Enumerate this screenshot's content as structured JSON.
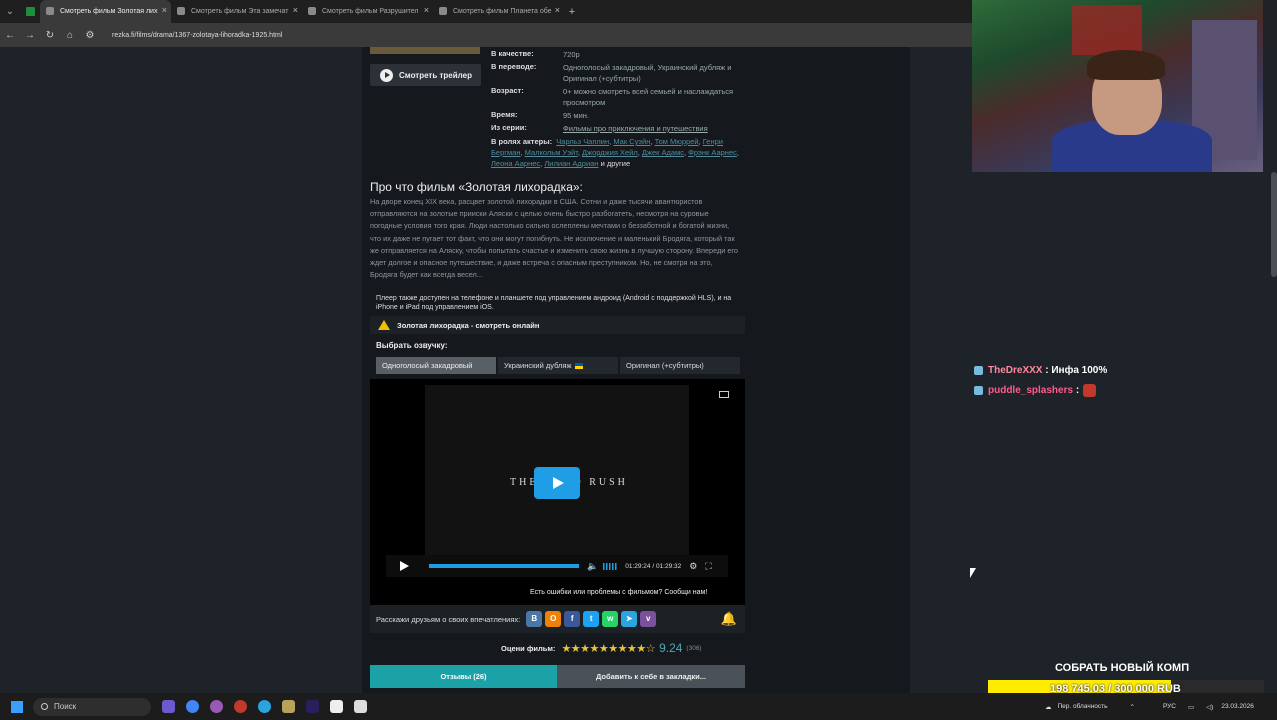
{
  "browser": {
    "tabs": [
      {
        "title": "Смотреть фильм Золотая лих",
        "active": true
      },
      {
        "title": "Смотреть фильм Эта замечат",
        "active": false
      },
      {
        "title": "Смотреть фильм Разрушител",
        "active": false
      },
      {
        "title": "Смотреть фильм Планета обе",
        "active": false
      }
    ],
    "new_tab": "+",
    "url": "rezka.fi/films/drama/1367-zolotaya-lihoradka-1925.html"
  },
  "movie": {
    "trailer_button": "Смотреть трейлер",
    "info": [
      {
        "key": "В качестве:",
        "value": "720p"
      },
      {
        "key": "В переводе:",
        "value": "Одноголосый закадровый, Украинский дубляж и Оригинал (+субтитры)"
      },
      {
        "key": "Возраст:",
        "value": "0+ можно смотреть всей семьей и наслаждаться просмотром"
      },
      {
        "key": "Время:",
        "value": "95 мин."
      }
    ],
    "series_label": "Из серии:",
    "series_value": "Фильмы про приключения и путешествия",
    "actors_label": "В ролях актеры:",
    "actors": [
      "Чарльз Чаплин",
      "Мак Суэйн",
      "Том Мюррей",
      "Генри Бергман",
      "Малкольм Уэйт",
      "Джорджия Хейл",
      "Джек Адамс",
      "Фрэнк Аарнес",
      "Леона Аарнес",
      "Лилиан Адриан"
    ],
    "actors_more": "и другие",
    "about_title": "Про что фильм «Золотая лихорадка»:",
    "about_text": "На дворе конец XIX века, расцвет золотой лихорадки в США. Сотни и даже тысячи авантюристов отправляются на золотые прииски Аляски с целью очень быстро разбогатеть, несмотря на суровые погодные условия того края. Люди настолько сильно ослеплены мечтами о беззаботной и богатой жизни, что их даже не пугает тот факт, что они могут погибнуть. Не исключение и маленький Бродяга, который так же отправляется на Аляску, чтобы попытать счастье и изменить свою жизнь в лучшую сторону. Впереди его ждет долгое и опасное путешествие, и даже встреча с опасным преступником. Но, не смотря на это, Бродяга будет как всегда весел..."
  },
  "player": {
    "note": "Плеер также доступен на телефоне и планшете под управлением андроид (Android с поддержкой HLS), и на iPhone и iPad под управлением iOS.",
    "watch_title": "Золотая лихорадка - смотреть онлайн",
    "voice_label": "Выбрать озвучку:",
    "voices": [
      "Одноголосый закадровый",
      "Украинский дубляж",
      "Оригинал (+субтитры)"
    ],
    "selected_voice": "Одноголосый закадровый",
    "logo_text": "THE GOLD RUSH",
    "time_display": "01:29:24 / 01:29:32",
    "progress": 0.998,
    "error_text": "Есть ошибки или проблемы с фильмом? Сообщи нам!",
    "share_text": "Расскажи друзьям о своих впечатлениях:",
    "rating_label": "Оцени фильм:",
    "rating_score": "9.24",
    "rating_count": "(306)",
    "reviews_button": "Отзывы (26)",
    "bookmark_button": "Добавить к себе в закладки..."
  },
  "stream": {
    "chat": [
      {
        "user": "TheDreXXX",
        "message": ": Инфа 100%"
      },
      {
        "user": "puddle_splashers",
        "message": ":"
      }
    ],
    "goal_title": "СОБРАТЬ НОВЫЙ КОМП",
    "goal_text": "198 745.03 / 300 000 RUB",
    "goal_fraction": 0.6625
  },
  "taskbar": {
    "search_placeholder": "Поиск",
    "weather": "Пер. облачность",
    "lang": "РУС",
    "date": "23.03.2026"
  },
  "colors": {
    "accent": "#1aa2a7",
    "player_blue": "#1f9ee5",
    "goal_yellow": "#ffec00"
  }
}
